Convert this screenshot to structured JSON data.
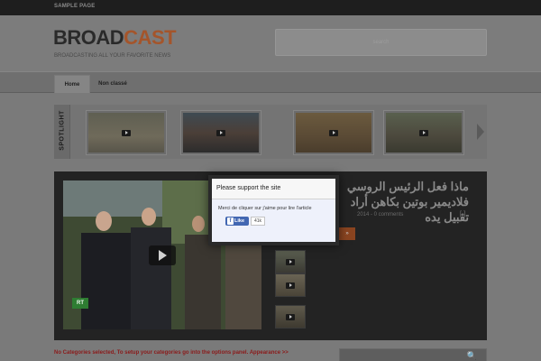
{
  "topbar": {
    "link": "SAMPLE PAGE"
  },
  "header": {
    "logo_part1": "BROAD",
    "logo_part2": "CAST",
    "tagline": "BROADCASTING ALL YOUR FAVORITE NEWS",
    "search_placeholder": "search"
  },
  "nav": {
    "tabs": [
      "Home",
      "Non classé"
    ]
  },
  "spotlight": {
    "label": "SPOTLIGHT",
    "thumb_count": 4
  },
  "featured": {
    "title": "ماذا فعل الرئيس الروسي فلاديمير بوتين بكاهن أراد تقبيل يده",
    "meta": "2014 - 0 comments",
    "meta_icon": "[-]",
    "video_logo": "RT"
  },
  "notice": "No Categories selected, To setup your categories go into the options panel. Appearance >>",
  "modal": {
    "title": "Please support the site",
    "text": "Merci de cliquer sur j'aime pour lire l'article",
    "like_label": "Like",
    "like_count": "41k"
  },
  "colors": {
    "logo_accent": "#a4552b",
    "notice": "#8b1a1a",
    "facebook": "#4267b2"
  }
}
